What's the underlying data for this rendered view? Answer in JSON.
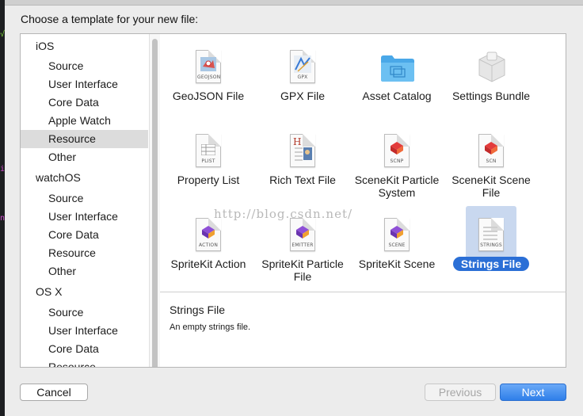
{
  "dialog": {
    "title": "Choose a template for your new file:"
  },
  "sidebar": {
    "rows": [
      {
        "label": "iOS",
        "kind": "section"
      },
      {
        "label": "Source",
        "kind": "item"
      },
      {
        "label": "User Interface",
        "kind": "item"
      },
      {
        "label": "Core Data",
        "kind": "item"
      },
      {
        "label": "Apple Watch",
        "kind": "item"
      },
      {
        "label": "Resource",
        "kind": "item",
        "selected": true
      },
      {
        "label": "Other",
        "kind": "item"
      },
      {
        "label": "watchOS",
        "kind": "section"
      },
      {
        "label": "Source",
        "kind": "item"
      },
      {
        "label": "User Interface",
        "kind": "item"
      },
      {
        "label": "Core Data",
        "kind": "item"
      },
      {
        "label": "Resource",
        "kind": "item"
      },
      {
        "label": "Other",
        "kind": "item"
      },
      {
        "label": "OS X",
        "kind": "section"
      },
      {
        "label": "Source",
        "kind": "item"
      },
      {
        "label": "User Interface",
        "kind": "item"
      },
      {
        "label": "Core Data",
        "kind": "item"
      },
      {
        "label": "Resource",
        "kind": "item"
      }
    ]
  },
  "templates": [
    {
      "label": "GeoJSON File",
      "icon": "geojson-file-icon",
      "tag": "GEOJSON"
    },
    {
      "label": "GPX File",
      "icon": "gpx-file-icon",
      "tag": "GPX"
    },
    {
      "label": "Asset Catalog",
      "icon": "folder-icon"
    },
    {
      "label": "Settings Bundle",
      "icon": "settings-bundle-icon"
    },
    {
      "label": "Property List",
      "icon": "plist-file-icon",
      "tag": "PLIST"
    },
    {
      "label": "Rich Text File",
      "icon": "rich-text-file-icon"
    },
    {
      "label": "SceneKit Particle System",
      "icon": "scenekit-particle-icon",
      "tag": "SCNP"
    },
    {
      "label": "SceneKit Scene File",
      "icon": "scenekit-scene-icon",
      "tag": "SCN"
    },
    {
      "label": "SpriteKit Action",
      "icon": "spritekit-action-icon",
      "tag": "ACTION"
    },
    {
      "label": "SpriteKit Particle File",
      "icon": "spritekit-particle-icon",
      "tag": "EMITTER"
    },
    {
      "label": "SpriteKit Scene",
      "icon": "spritekit-scene-icon",
      "tag": "SCENE"
    },
    {
      "label": "Strings File",
      "icon": "strings-file-icon",
      "tag": "STRINGS",
      "selected": true
    }
  ],
  "watermark": "http://blog.csdn.net/",
  "description": {
    "title": "Strings File",
    "text": "An empty strings file."
  },
  "buttons": {
    "cancel": "Cancel",
    "previous": "Previous",
    "next": "Next"
  },
  "colors": {
    "accent": "#2b6fd6",
    "selection_bg": "#c9d8ef",
    "sidebar_selected": "#dcdcdc"
  }
}
